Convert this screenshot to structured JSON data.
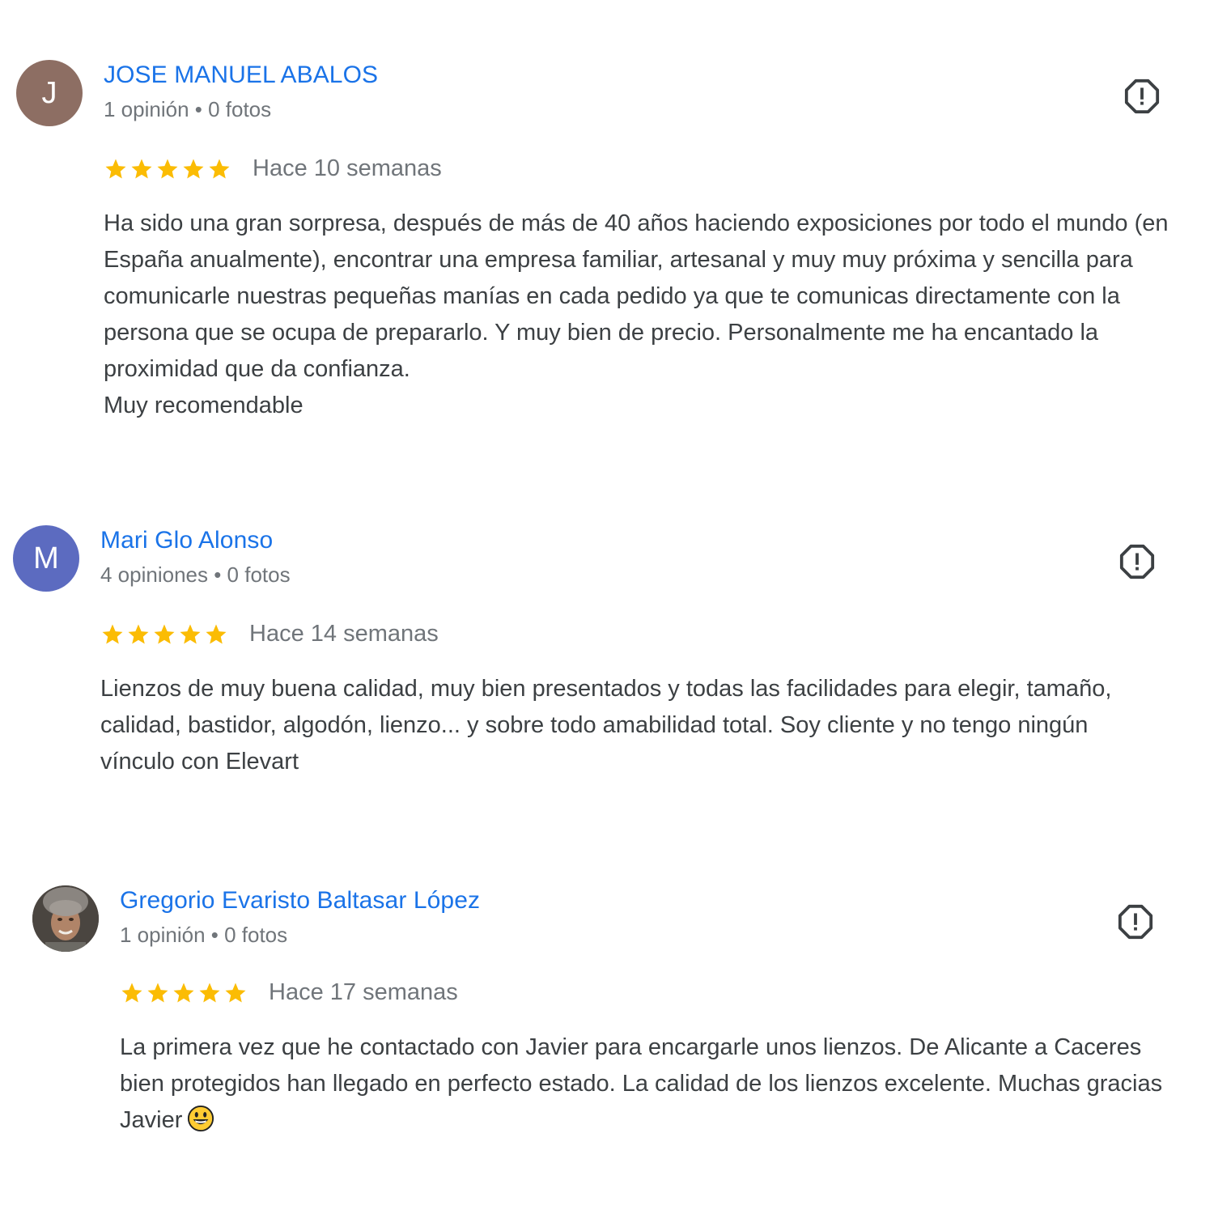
{
  "accent_color": "#1a73e8",
  "star_color": "#fbbc04",
  "reviews": [
    {
      "avatar": {
        "letter": "J",
        "color": "#8d6e63"
      },
      "name": "JOSE MANUEL ABALOS",
      "meta": "1 opinión • 0 fotos",
      "rating": 5,
      "date": "Hace 10 semanas",
      "text": "Ha sido una gran sorpresa, después de más de 40 años haciendo exposiciones por todo el mundo (en España anualmente), encontrar una empresa familiar, artesanal y muy muy próxima y sencilla para comunicarle nuestras pequeñas manías en cada pedido ya que te comunicas directamente con la persona que se ocupa de prepararlo. Y muy bien de precio. Personalmente me ha encantado la proximidad que da confianza.",
      "text2": "Muy recomendable"
    },
    {
      "avatar": {
        "letter": "M",
        "color": "#5c6bc0"
      },
      "name": "Mari Glo Alonso",
      "meta": "4 opiniones • 0 fotos",
      "rating": 5,
      "date": "Hace 14 semanas",
      "text": "Lienzos de muy buena calidad, muy bien presentados y todas las facilidades para elegir, tamaño, calidad, bastidor, algodón, lienzo... y sobre todo amabilidad total. Soy cliente y no tengo ningún vínculo con Elevart"
    },
    {
      "avatar": {
        "photo": "man-portrait"
      },
      "name": "Gregorio Evaristo Baltasar López",
      "meta": "1 opinión • 0 fotos",
      "rating": 5,
      "date": "Hace 17 semanas",
      "text": "La primera vez que he contactado con Javier para encargarle unos lienzos. De Alicante a Caceres bien protegidos han llegado en perfecto estado. La calidad de los lienzos excelente. Muchas gracias Javier",
      "emoji": "grinning-face"
    }
  ]
}
